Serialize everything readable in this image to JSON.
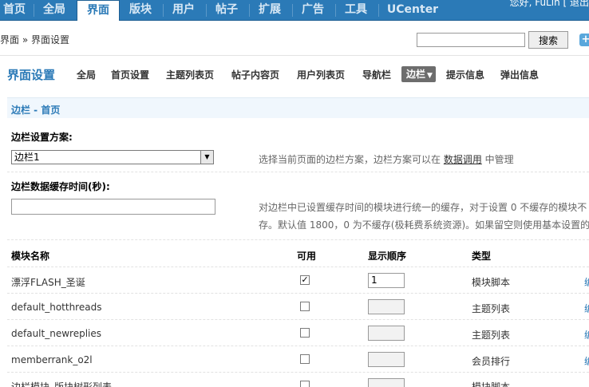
{
  "topnav": {
    "items": [
      "首页",
      "全局",
      "界面",
      "版块",
      "用户",
      "帖子",
      "扩展",
      "广告",
      "工具",
      "UCenter"
    ],
    "active_index": 2,
    "user_greeting": "您好, FuLin [ 退出"
  },
  "breadcrumb": {
    "text": "界面 » 界面设置"
  },
  "search": {
    "value": "",
    "button_label": "搜索",
    "plus_label": "+"
  },
  "page_title": "界面设置",
  "subtabs": [
    "全局",
    "首页设置",
    "主题列表页",
    "帖子内容页",
    "用户列表页",
    "导航栏",
    "边栏",
    "提示信息",
    "弹出信息"
  ],
  "active_subtab": "边栏",
  "section_title": "边栏 - 首页",
  "scheme": {
    "label": "边栏设置方案:",
    "selected": "边栏1",
    "hint_pre": "选择当前页面的边栏方案，边栏方案可以在 ",
    "hint_link": "数据调用",
    "hint_post": " 中管理"
  },
  "cache": {
    "label": "边栏数据缓存时间(秒):",
    "value": "",
    "hint_line1": "对边栏中已设置缓存时间的模块进行统一的缓存，对于设置 0 不缓存的模块不",
    "hint_line2": "存。默认值 1800，0 为不缓存(极耗费系统资源)。如果留空则使用基本设置的"
  },
  "table": {
    "headers": [
      "模块名称",
      "可用",
      "显示顺序",
      "类型"
    ],
    "rows": [
      {
        "name": "漂浮FLASH_圣诞",
        "enabled": true,
        "order": "1",
        "type": "模块脚本"
      },
      {
        "name": "default_hotthreads",
        "enabled": false,
        "order": "",
        "type": "主题列表"
      },
      {
        "name": "default_newreplies",
        "enabled": false,
        "order": "",
        "type": "主题列表"
      },
      {
        "name": "memberrank_o2l",
        "enabled": false,
        "order": "",
        "type": "会员排行"
      },
      {
        "name": "边栏模块_版块树形列表",
        "enabled": false,
        "order": "",
        "type": "模块脚本"
      }
    ],
    "edge_link_text": "编"
  },
  "colors": {
    "nav_bg": "#2b7ab7",
    "accent": "#2b7ab7",
    "section_bg": "#f0f7fd"
  }
}
